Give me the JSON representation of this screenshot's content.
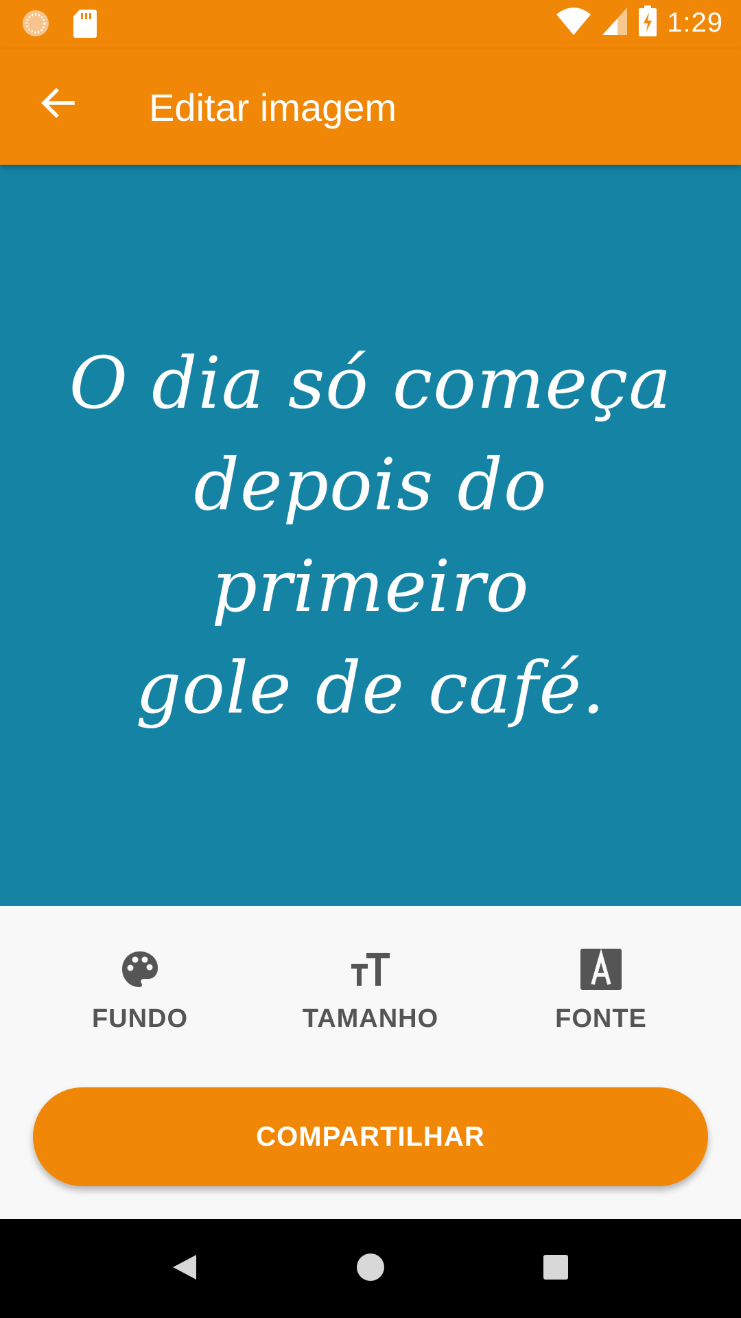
{
  "status_bar": {
    "time": "1:29",
    "icons": [
      "sync-icon",
      "sd-card-icon",
      "wifi-icon",
      "signal-icon",
      "battery-charging-icon"
    ]
  },
  "app_bar": {
    "title": "Editar imagem",
    "back_icon": "arrow-back-icon"
  },
  "canvas": {
    "background_color": "#1583a4",
    "text_color": "#ffffff",
    "quote_lines": [
      "O dia só começa",
      "depois do primeiro",
      "gole de café."
    ]
  },
  "tools": [
    {
      "icon": "palette-icon",
      "label": "FUNDO"
    },
    {
      "icon": "text-size-icon",
      "label": "TAMANHO"
    },
    {
      "icon": "font-icon",
      "label": "FONTE"
    }
  ],
  "share_button": {
    "label": "COMPARTILHAR"
  },
  "colors": {
    "accent": "#f08706",
    "tool_icon": "#555555"
  },
  "nav_bar": {
    "icons": [
      "back-triangle-icon",
      "home-circle-icon",
      "recents-square-icon"
    ]
  }
}
